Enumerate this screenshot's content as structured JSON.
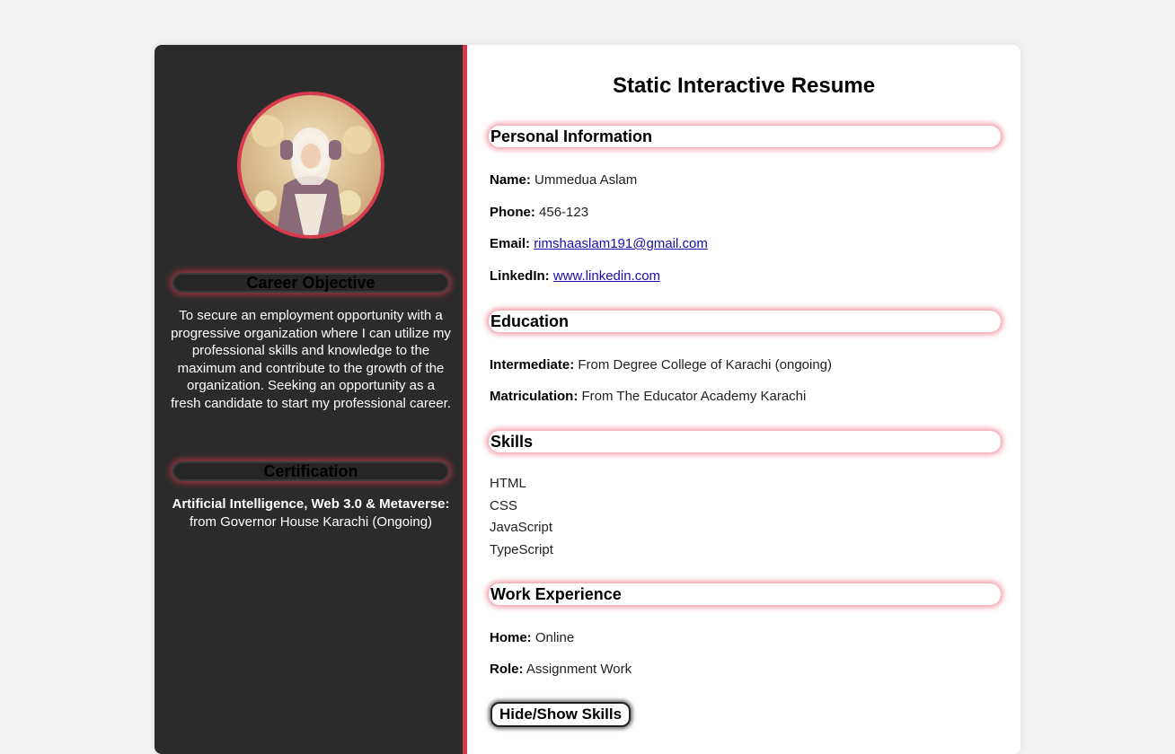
{
  "sidebar": {
    "career_objective_title": "Career Objective",
    "career_objective_text": "To secure an employment opportunity with a progressive organization where I can utilize my professional skills and knowledge to the maximum and contribute to the growth of the organization. Seeking an opportunity as a fresh candidate to start my professional career.",
    "certification_title": "Certification",
    "certification_name": "Artificial Intelligence, Web 3.0 & Metaverse:",
    "certification_detail": "from Governor House Karachi (Ongoing)"
  },
  "main": {
    "title": "Static Interactive Resume",
    "personal": {
      "heading": "Personal Information",
      "name_label": "Name:",
      "name_value": "Ummedua Aslam",
      "phone_label": "Phone:",
      "phone_value": "456-123",
      "email_label": "Email:",
      "email_value": "rimshaaslam191@gmail.com",
      "linkedin_label": "LinkedIn:",
      "linkedin_value": "www.linkedin.com"
    },
    "education": {
      "heading": "Education",
      "intermediate_label": "Intermediate:",
      "intermediate_value": "From Degree College of Karachi (ongoing)",
      "matric_label": "Matriculation:",
      "matric_value": "From The Educator Academy Karachi"
    },
    "skills": {
      "heading": "Skills",
      "items": [
        "HTML",
        "CSS",
        "JavaScript",
        "TypeScript"
      ]
    },
    "work": {
      "heading": "Work Experience",
      "home_label": "Home:",
      "home_value": "Online",
      "role_label": "Role:",
      "role_value": "Assignment Work"
    },
    "toggle_label": "Hide/Show Skills"
  },
  "colors": {
    "accent": "#d63a4e",
    "sidebar_bg": "#2b2b2b",
    "page_bg": "#f2f2f2"
  }
}
